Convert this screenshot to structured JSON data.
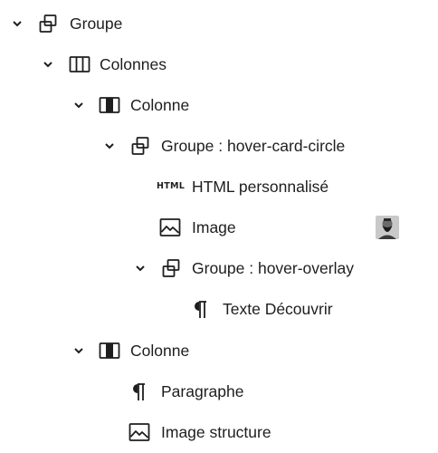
{
  "list_view": {
    "items": [
      {
        "label": "Groupe",
        "icon": "group-icon",
        "expanded": true
      },
      {
        "label": "Colonnes",
        "icon": "columns-icon",
        "expanded": true
      },
      {
        "label": "Colonne",
        "icon": "column-icon",
        "expanded": true
      },
      {
        "label": "Groupe : hover-card-circle",
        "icon": "group-icon",
        "expanded": true
      },
      {
        "label": "HTML personnalisé",
        "icon": "html-icon",
        "glyph": "HTML"
      },
      {
        "label": "Image",
        "icon": "image-icon",
        "has_thumbnail": true
      },
      {
        "label": "Groupe : hover-overlay",
        "icon": "group-icon",
        "expanded": true
      },
      {
        "label": "Texte Découvrir",
        "icon": "paragraph-icon"
      },
      {
        "label": "Colonne",
        "icon": "column-icon",
        "expanded": true
      },
      {
        "label": "Paragraphe",
        "icon": "paragraph-icon"
      },
      {
        "label": "Image structure",
        "icon": "image-icon"
      }
    ]
  },
  "colors": {
    "text": "#1e1e1e",
    "background": "#ffffff"
  }
}
